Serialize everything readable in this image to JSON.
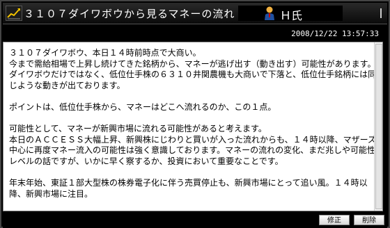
{
  "window": {
    "title": "３１０７ダイワボウから見るマネーの流れ",
    "user_name": "Ｈ氏",
    "timestamp": "2008/12/22 13:57:33"
  },
  "post": {
    "paragraphs": [
      "３１０７ダイワボウ、本日１４時前時点で大商い。\n今まで需給相場で上昇し続けてきた銘柄から、マネーが逃げ出す（動き出す）可能性があります。ダイワボウだけではなく、低位仕手株の６３１０井関農機も大商いで下落と、低位仕手銘柄には同じような動きが出ております。",
      "ポイントは、低位仕手株から、マネーはどこへ流れるのか、この１点。",
      "可能性として、マネーが新興市場に流れる可能性があると考えます。\n本日のＡＣＣＥＳＳ大幅上昇、新興株にじわりと買いが入った流れからも、１４時以降、マザーズ中心に再度マネー流入の可能性は強く意識しております。マネーの流れの変化、まだ兆しや可能性レベルの話ですが、いかに早く察するか、投資において重要なことです。",
      "年末年始、東証１部大型株の株券電子化に伴う売買停止も、新興市場にとって追い風。１４時以降、新興市場に注目。"
    ]
  },
  "buttons": {
    "edit": "修正",
    "delete": "削除"
  }
}
